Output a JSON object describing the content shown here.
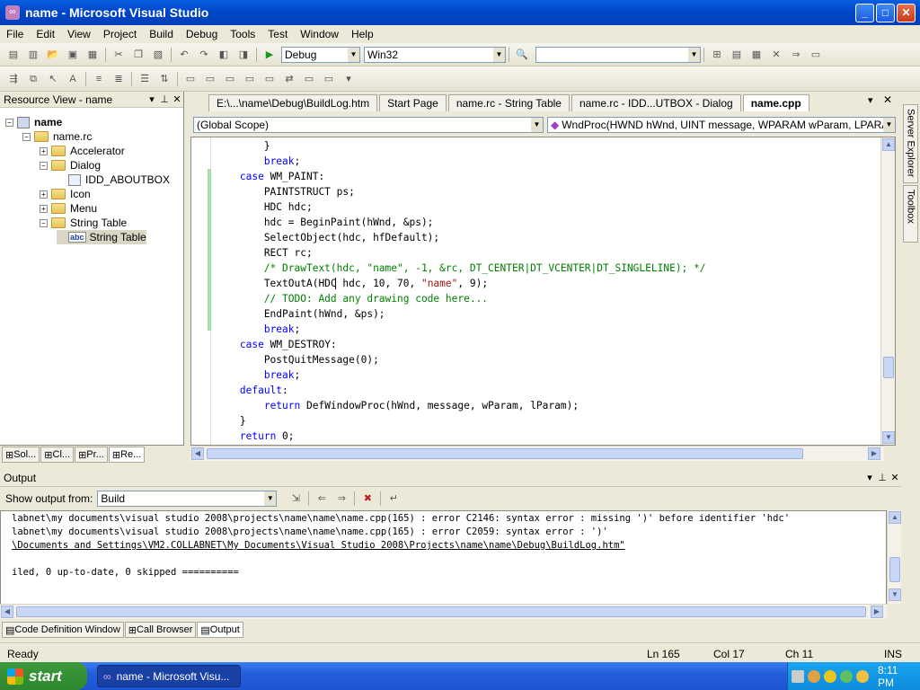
{
  "window": {
    "title": "name - Microsoft Visual Studio",
    "min": "_",
    "max": "□",
    "close": "✕"
  },
  "menu": [
    "File",
    "Edit",
    "View",
    "Project",
    "Build",
    "Debug",
    "Tools",
    "Test",
    "Window",
    "Help"
  ],
  "toolbar": {
    "config": "Debug",
    "platform": "Win32",
    "find": ""
  },
  "resource_view": {
    "title": "Resource View - name",
    "tree": [
      {
        "label": "name",
        "indent": 0,
        "kind": "project",
        "expander": "−"
      },
      {
        "label": "name.rc",
        "indent": 1,
        "kind": "folder",
        "expander": "−"
      },
      {
        "label": "Accelerator",
        "indent": 2,
        "kind": "folder",
        "expander": "+"
      },
      {
        "label": "Dialog",
        "indent": 2,
        "kind": "folder",
        "expander": "−"
      },
      {
        "label": "IDD_ABOUTBOX",
        "indent": 3,
        "kind": "file",
        "expander": ""
      },
      {
        "label": "Icon",
        "indent": 2,
        "kind": "folder",
        "expander": "+"
      },
      {
        "label": "Menu",
        "indent": 2,
        "kind": "folder",
        "expander": "+"
      },
      {
        "label": "String Table",
        "indent": 2,
        "kind": "folder",
        "expander": "−"
      },
      {
        "label": "String Table",
        "indent": 3,
        "kind": "abc",
        "expander": ""
      }
    ],
    "abc_label": "abc",
    "tabs": [
      "Sol...",
      "Cl...",
      "Pr...",
      "Re..."
    ]
  },
  "doc_tabs": [
    "E:\\...\\name\\Debug\\BuildLog.htm",
    "Start Page",
    "name.rc - String Table",
    "name.rc - IDD...UTBOX - Dialog",
    "name.cpp"
  ],
  "scope": {
    "left": "(Global Scope)",
    "right": "WndProc(HWND hWnd, UINT message, WPARAM wParam, LPARAM lPara"
  },
  "code_lines": [
    [
      {
        "t": "            }",
        "c": "tx"
      }
    ],
    [
      {
        "t": "            ",
        "c": "tx"
      },
      {
        "t": "break",
        "c": "kw"
      },
      {
        "t": ";",
        "c": "tx"
      }
    ],
    [
      {
        "t": "        ",
        "c": "tx"
      },
      {
        "t": "case",
        "c": "kw"
      },
      {
        "t": " WM_PAINT:",
        "c": "tx"
      }
    ],
    [
      {
        "t": "            PAINTSTRUCT ps;",
        "c": "tx"
      }
    ],
    [
      {
        "t": "            HDC hdc;",
        "c": "tx"
      }
    ],
    [
      {
        "t": "            hdc = BeginPaint(hWnd, &ps);",
        "c": "tx"
      }
    ],
    [
      {
        "t": "            SelectObject(hdc, hfDefault);",
        "c": "tx"
      }
    ],
    [
      {
        "t": "            RECT rc;",
        "c": "tx"
      }
    ],
    [
      {
        "t": "            /* DrawText(hdc, \"name\", -1, &rc, DT_CENTER|DT_VCENTER|DT_SINGLELINE); */",
        "c": "cm"
      }
    ],
    [
      {
        "t": "            TextOutA(HDC hdc, 10, 70, ",
        "c": "tx"
      },
      {
        "t": "\"name\"",
        "c": "st"
      },
      {
        "t": ", 9);",
        "c": "tx"
      }
    ],
    [
      {
        "t": "            // TODO: Add any drawing code here...",
        "c": "cm"
      }
    ],
    [
      {
        "t": "            EndPaint(hWnd, &ps);",
        "c": "tx"
      }
    ],
    [
      {
        "t": "            ",
        "c": "tx"
      },
      {
        "t": "break",
        "c": "kw"
      },
      {
        "t": ";",
        "c": "tx"
      }
    ],
    [
      {
        "t": "        ",
        "c": "tx"
      },
      {
        "t": "case",
        "c": "kw"
      },
      {
        "t": " WM_DESTROY:",
        "c": "tx"
      }
    ],
    [
      {
        "t": "            PostQuitMessage(0);",
        "c": "tx"
      }
    ],
    [
      {
        "t": "            ",
        "c": "tx"
      },
      {
        "t": "break",
        "c": "kw"
      },
      {
        "t": ";",
        "c": "tx"
      }
    ],
    [
      {
        "t": "        ",
        "c": "tx"
      },
      {
        "t": "default",
        "c": "kw"
      },
      {
        "t": ":",
        "c": "tx"
      }
    ],
    [
      {
        "t": "            ",
        "c": "tx"
      },
      {
        "t": "return",
        "c": "kw"
      },
      {
        "t": " DefWindowProc(hWnd, message, wParam, lParam);",
        "c": "tx"
      }
    ],
    [
      {
        "t": "        }",
        "c": "tx"
      }
    ],
    [
      {
        "t": "        ",
        "c": "tx"
      },
      {
        "t": "return",
        "c": "kw"
      },
      {
        "t": " 0;",
        "c": "tx"
      }
    ]
  ],
  "side_tabs": [
    "Server Explorer",
    "Toolbox"
  ],
  "output": {
    "title": "Output",
    "show_from_label": "Show output from:",
    "show_from_value": "Build",
    "lines": [
      "labnet\\my documents\\visual studio 2008\\projects\\name\\name\\name.cpp(165) : error C2146: syntax error : missing ')' before identifier 'hdc'",
      "labnet\\my documents\\visual studio 2008\\projects\\name\\name\\name.cpp(165) : error C2059: syntax error : ')'",
      "\\Documents and Settings\\VM2.COLLABNET\\My Documents\\Visual Studio 2008\\Projects\\name\\name\\Debug\\BuildLog.htm\"",
      "",
      "iled, 0 up-to-date, 0 skipped =========="
    ],
    "tabs": [
      "Code Definition Window",
      "Call Browser",
      "Output"
    ]
  },
  "status": {
    "ready": "Ready",
    "ln": "Ln 165",
    "col": "Col 17",
    "ch": "Ch 11",
    "ins": "INS"
  },
  "taskbar": {
    "start": "start",
    "task": "name - Microsoft Visu...",
    "time": "8:11 PM"
  }
}
